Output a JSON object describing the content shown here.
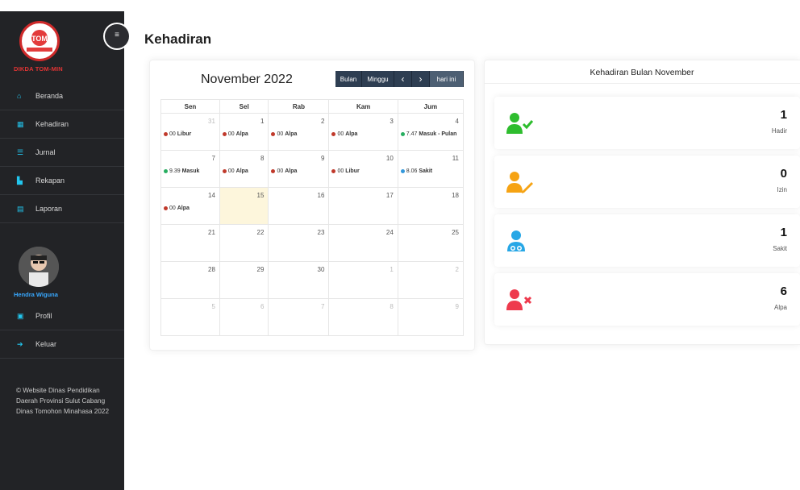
{
  "sidebar": {
    "brand": "DIKDA TOM-MIN",
    "logo_text": "CABANG TOMMIN",
    "items": [
      {
        "label": "Beranda",
        "icon": "home-icon"
      },
      {
        "label": "Kehadiran",
        "icon": "calendar-icon"
      },
      {
        "label": "Jurnal",
        "icon": "list-icon"
      },
      {
        "label": "Rekapan",
        "icon": "book-icon"
      },
      {
        "label": "Laporan",
        "icon": "file-icon"
      }
    ],
    "user_name": "Hendra Wiguna",
    "user_items": [
      {
        "label": "Profil",
        "icon": "id-card-icon"
      },
      {
        "label": "Keluar",
        "icon": "sign-out-icon"
      }
    ],
    "footer": "© Website Dinas Pendidikan Daerah Provinsi Sulut Cabang Dinas Tomohon Minahasa 2022"
  },
  "page_title": "Kehadiran",
  "calendar": {
    "title": "November 2022",
    "buttons": {
      "month": "Bulan",
      "week": "Minggu",
      "prev": "‹",
      "next": "›",
      "today": "hari ini"
    },
    "weekdays": [
      "Sen",
      "Sel",
      "Rab",
      "Kam",
      "Jum"
    ],
    "weeks": [
      [
        {
          "day": "31",
          "out": true,
          "event": {
            "time": "00",
            "label": "Libur",
            "color": "#c0392b"
          }
        },
        {
          "day": "1",
          "event": {
            "time": "00",
            "label": "Alpa",
            "color": "#c0392b"
          }
        },
        {
          "day": "2",
          "event": {
            "time": "00",
            "label": "Alpa",
            "color": "#c0392b"
          }
        },
        {
          "day": "3",
          "event": {
            "time": "00",
            "label": "Alpa",
            "color": "#c0392b"
          }
        },
        {
          "day": "4",
          "event": {
            "time": "7.47",
            "label": "Masuk - Pulan",
            "color": "#27ae60"
          }
        }
      ],
      [
        {
          "day": "7",
          "event": {
            "time": "9.39",
            "label": "Masuk",
            "color": "#27ae60"
          }
        },
        {
          "day": "8",
          "event": {
            "time": "00",
            "label": "Alpa",
            "color": "#c0392b"
          }
        },
        {
          "day": "9",
          "event": {
            "time": "00",
            "label": "Alpa",
            "color": "#c0392b"
          }
        },
        {
          "day": "10",
          "event": {
            "time": "00",
            "label": "Libur",
            "color": "#c0392b"
          }
        },
        {
          "day": "11",
          "event": {
            "time": "8.06",
            "label": "Sakit",
            "color": "#3498db"
          }
        }
      ],
      [
        {
          "day": "14",
          "event": {
            "time": "00",
            "label": "Alpa",
            "color": "#c0392b"
          }
        },
        {
          "day": "15",
          "today": true
        },
        {
          "day": "16"
        },
        {
          "day": "17"
        },
        {
          "day": "18"
        }
      ],
      [
        {
          "day": "21"
        },
        {
          "day": "22"
        },
        {
          "day": "23"
        },
        {
          "day": "24"
        },
        {
          "day": "25"
        }
      ],
      [
        {
          "day": "28"
        },
        {
          "day": "29"
        },
        {
          "day": "30"
        },
        {
          "day": "1",
          "out": true
        },
        {
          "day": "2",
          "out": true
        }
      ],
      [
        {
          "day": "5",
          "out": true
        },
        {
          "day": "6",
          "out": true
        },
        {
          "day": "7",
          "out": true
        },
        {
          "day": "8",
          "out": true
        },
        {
          "day": "9",
          "out": true
        }
      ]
    ]
  },
  "summary": {
    "title": "Kehadiran Bulan November",
    "stats": [
      {
        "value": "1",
        "label": "Hadir",
        "icon": "user-check-icon",
        "color": "#2ebd2e"
      },
      {
        "value": "0",
        "label": "Izin",
        "icon": "user-edit-icon",
        "color": "#f6a313"
      },
      {
        "value": "1",
        "label": "Sakit",
        "icon": "user-doctor-icon",
        "color": "#27a7e6"
      },
      {
        "value": "6",
        "label": "Alpa",
        "icon": "user-times-icon",
        "color": "#ee3a4d"
      }
    ]
  }
}
